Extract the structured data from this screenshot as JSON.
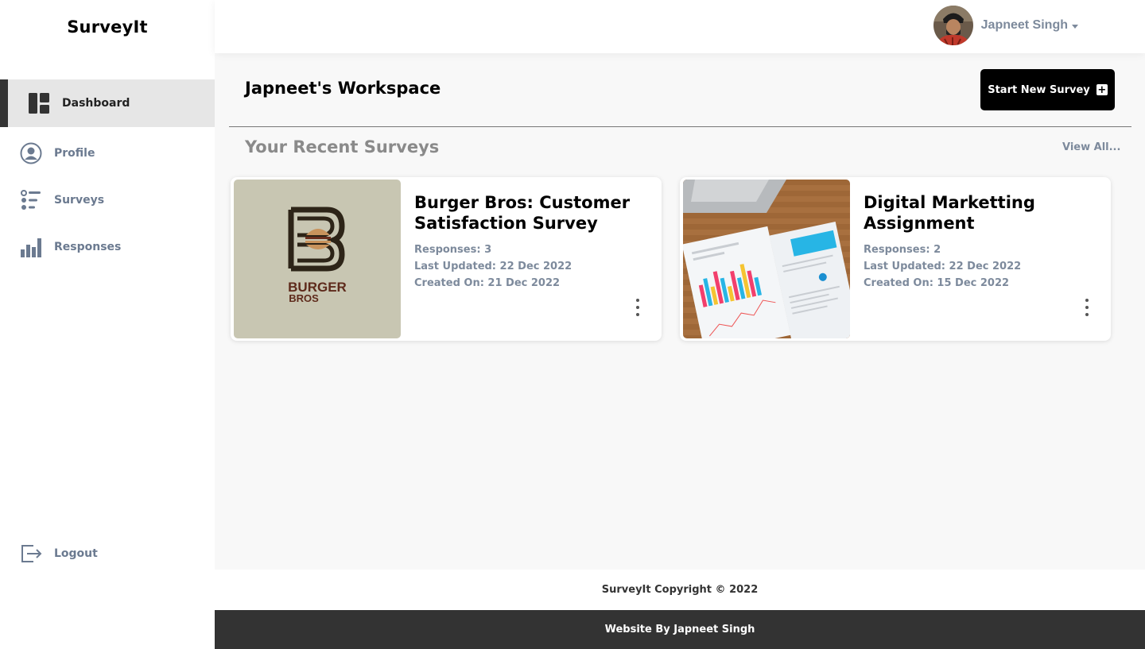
{
  "app": {
    "brand": "SurveyIt"
  },
  "sidebar": {
    "items": [
      {
        "label": "Dashboard",
        "icon": "dashboard-icon",
        "active": true
      },
      {
        "label": "Profile",
        "icon": "profile-icon",
        "active": false
      },
      {
        "label": "Surveys",
        "icon": "list-icon",
        "active": false
      },
      {
        "label": "Responses",
        "icon": "bar-chart-icon",
        "active": false
      }
    ],
    "logout": {
      "label": "Logout",
      "icon": "logout-icon"
    }
  },
  "header": {
    "user_name": "Japneet Singh",
    "avatar": "user-avatar",
    "dropdown_icon": "caret-down-icon"
  },
  "main": {
    "workspace_title": "Japneet's Workspace",
    "new_survey_label": "Start New Survey",
    "recent_title": "Your Recent Surveys",
    "view_all_label": "View All...",
    "surveys": [
      {
        "title": "Burger Bros: Customer Satisfaction Survey",
        "responses": "Responses: 3",
        "last_updated": "Last Updated: 22 Dec 2022",
        "created_on": "Created On: 21 Dec 2022",
        "logo_text_1": "BURGER",
        "logo_text_2": "BROS"
      },
      {
        "title": "Digital Marketting Assignment",
        "responses": "Responses: 2",
        "last_updated": "Last Updated: 22 Dec 2022",
        "created_on": "Created On: 15 Dec 2022"
      }
    ]
  },
  "footer": {
    "copyright": "SurveyIt Copyright © 2022",
    "credit": "Website By Japneet Singh"
  },
  "colors": {
    "accent": "#000000",
    "sidebar_active_bg": "#e6e6e6",
    "muted_text": "#7d8a9c",
    "footer_dark": "#333333"
  }
}
